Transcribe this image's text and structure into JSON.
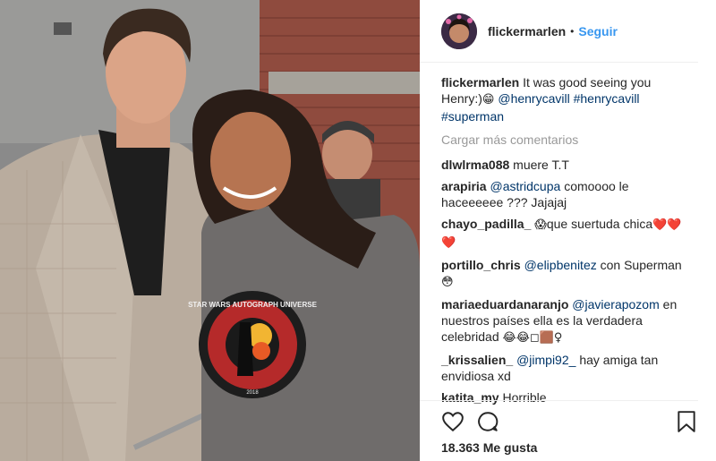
{
  "post": {
    "username": "flickermarlen",
    "dot": "•",
    "follow_label": "Seguir",
    "shirt_text_top": "STAR WARS AUTOGRAPH UNIVERSE",
    "shirt_text_year": "2018",
    "caption": {
      "username": "flickermarlen",
      "text": "It was good seeing you Henry:)",
      "emoji": "😁",
      "mention": "@henrycavill",
      "hashtag1": "#henrycavill",
      "hashtag2": "#superman"
    },
    "load_more": "Cargar más comentarios",
    "likes": "18.363 Me gusta"
  },
  "comments": [
    {
      "username": "dlwlrma088",
      "text": "muere T.T"
    },
    {
      "username": "arapiria",
      "mention": "@astridcupa",
      "text": "comoooo le haceeeeee ??? Jajajaj"
    },
    {
      "username": "chayo_padilla_",
      "emoji": "😱",
      "text": "que suertuda chica",
      "hearts": "❤️❤️❤️"
    },
    {
      "username": "portillo_chris",
      "mention": "@elipbenitez",
      "text": "con Superman",
      "emoji": "😳"
    },
    {
      "username": "mariaeduardanaranjo",
      "mention": "@javierapozom",
      "text": "en nuestros países ella es la verdadera celebridad",
      "emoji": "😂😂◻🟫♀"
    },
    {
      "username": "_krissalien_",
      "mention": "@jimpi92_",
      "text": "hay amiga tan envidiosa xd"
    },
    {
      "username": "katita_my",
      "text": "Horrible"
    }
  ],
  "icons": {
    "like": "heart-outline-icon",
    "comment": "speech-bubble-icon",
    "save": "bookmark-icon"
  }
}
